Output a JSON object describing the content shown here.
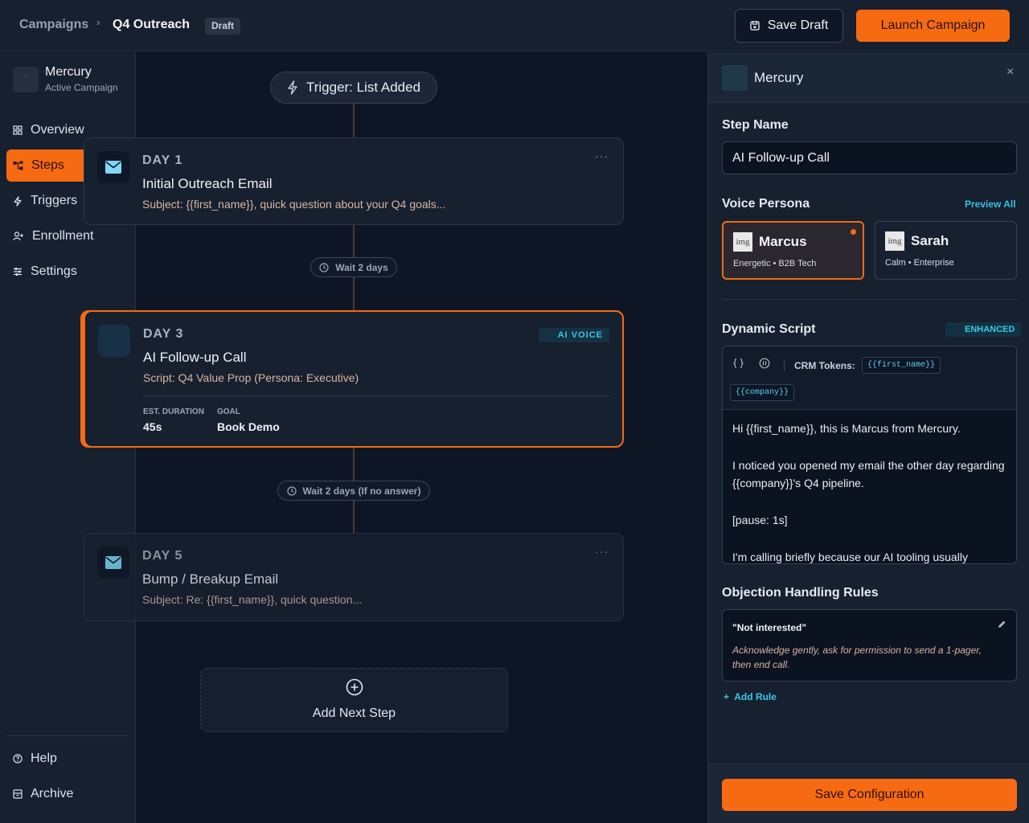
{
  "header": {
    "breadcrumb_root": "Campaigns",
    "breadcrumb_sep": "›",
    "breadcrumb_current": "Q4 Outreach",
    "status_badge": "Draft",
    "save_draft_label": "Save Draft",
    "launch_label": "Launch Campaign"
  },
  "sidebar": {
    "workspace_avatar": "·",
    "workspace_name": "Mercury",
    "workspace_status": "Active Campaign",
    "items": [
      {
        "label": "Overview",
        "icon": "grid-icon"
      },
      {
        "label": "Steps",
        "icon": "flow-icon"
      },
      {
        "label": "Triggers",
        "icon": "bolt-icon"
      },
      {
        "label": "Enrollment",
        "icon": "user-plus-icon"
      },
      {
        "label": "Settings",
        "icon": "sliders-icon"
      }
    ],
    "bottom_items": [
      {
        "label": "Help",
        "icon": "help-icon"
      },
      {
        "label": "Archive",
        "icon": "archive-icon"
      }
    ]
  },
  "canvas": {
    "trigger_label": "Trigger: List Added",
    "steps": [
      {
        "day": "DAY 1",
        "title": "Initial Outreach Email",
        "subtitle": "Subject: {{first_name}}, quick question about your Q4 goals...",
        "more": "···"
      },
      {
        "day": "DAY 3",
        "title": "AI Follow-up Call",
        "subtitle": "Script: Q4 Value Prop (Persona: Executive)",
        "badge": "AI VOICE",
        "meta": [
          {
            "label": "EST. DURATION",
            "value": "45s"
          },
          {
            "label": "GOAL",
            "value": "Book Demo"
          }
        ]
      },
      {
        "day": "DAY 5",
        "title": "Bump / Breakup Email",
        "subtitle": "Subject: Re: {{first_name}}, quick question...",
        "more": "···"
      }
    ],
    "waits": [
      "Wait 2 days",
      "Wait 2 days (If no answer)"
    ],
    "add_step_label": "Add Next Step"
  },
  "panel": {
    "title": "Mercury",
    "close": "×",
    "step_name_label": "Step Name",
    "step_name_value": "AI Follow-up Call",
    "voice_persona_label": "Voice Persona",
    "preview_all": "Preview All",
    "personas": [
      {
        "img_alt": "img",
        "name": "Marcus",
        "desc": "Energetic • B2B Tech",
        "selected": true
      },
      {
        "img_alt": "img",
        "name": "Sarah",
        "desc": "Calm • Enterprise",
        "selected": false
      }
    ],
    "script_label": "Dynamic Script",
    "enhanced_badge": "ENHANCED",
    "crm_tokens_label": "CRM Tokens:",
    "tokens": [
      "{{first_name}}",
      "{{company}}"
    ],
    "script_paragraphs": [
      "Hi {{first_name}}, this is Marcus from Mercury.",
      "I noticed you opened my email the other day regarding {{company}}'s Q4 pipeline.",
      "[pause: 1s]",
      "I'm calling briefly because our AI tooling usually"
    ],
    "objection_label": "Objection Handling Rules",
    "rules": [
      {
        "title": "\"Not interested\"",
        "desc": "Acknowledge gently, ask for permission to send a 1-pager, then end call."
      }
    ],
    "add_rule_label": "Add Rule",
    "add_rule_plus": "+",
    "save_config_label": "Save Configuration"
  },
  "colors": {
    "accent": "#f66a12",
    "cyan": "#38c7e8",
    "background": "#0e1626",
    "surface": "#17202f"
  }
}
